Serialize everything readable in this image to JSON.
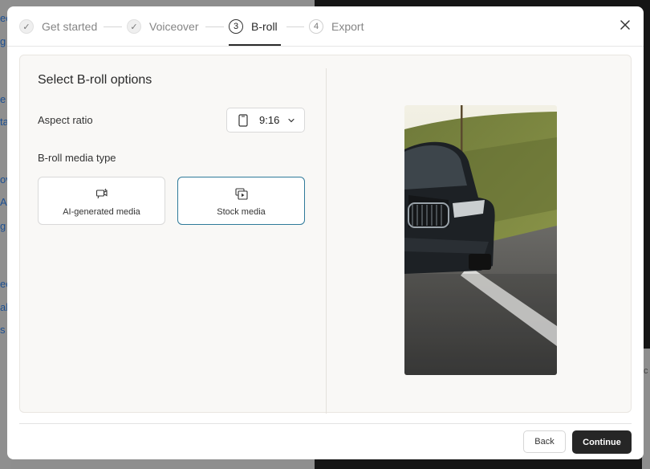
{
  "background": {
    "left_fragments": [
      "ec",
      "g a",
      "e a",
      "ta",
      "ov",
      "A",
      "g y",
      "ec",
      "ab",
      "s c"
    ],
    "right_fragment": "c"
  },
  "stepper": {
    "steps": [
      {
        "label": "Get started",
        "marker": "✓",
        "state": "done"
      },
      {
        "label": "Voiceover",
        "marker": "✓",
        "state": "done"
      },
      {
        "label": "B-roll",
        "marker": "3",
        "state": "active"
      },
      {
        "label": "Export",
        "marker": "4",
        "state": "upcoming"
      }
    ]
  },
  "options": {
    "title": "Select B-roll options",
    "aspect_ratio_label": "Aspect ratio",
    "aspect_ratio_value": "9:16",
    "media_type_label": "B-roll media type",
    "media_types": [
      {
        "label": "AI-generated media",
        "icon": "ai-media-icon",
        "selected": false
      },
      {
        "label": "Stock media",
        "icon": "stock-media-icon",
        "selected": true
      }
    ]
  },
  "footer": {
    "back_label": "Back",
    "continue_label": "Continue"
  },
  "colors": {
    "selected_border": "#2f7a9a",
    "primary_button": "#262626",
    "panel_bg": "#f9f8f6"
  }
}
